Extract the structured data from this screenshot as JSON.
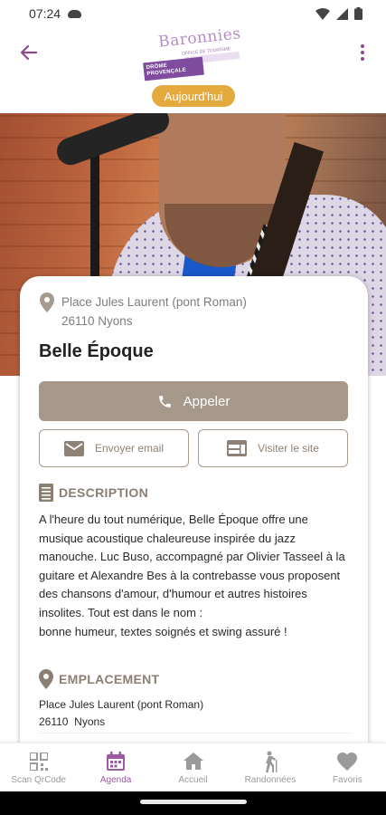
{
  "status_bar": {
    "time": "07:24"
  },
  "header": {
    "logo": {
      "name": "Baronnies",
      "tagline": "OFFICE DE TOURISME",
      "band_line1": "DRÔME",
      "band_line2": "PROVENÇALE"
    },
    "badge": "Aujourd'hui"
  },
  "event": {
    "address_line1": "Place Jules Laurent (pont Roman)",
    "address_line2": "26110 Nyons",
    "title": "Belle Époque",
    "call_label": "Appeler",
    "email_label": "Envoyer email",
    "website_label": "Visiter le site",
    "description_heading": "DESCRIPTION",
    "description": "A l'heure du tout numérique, Belle Époque offre une musique acoustique chaleureuse inspirée du jazz manouche. Luc Buso, accompagné par Olivier Tasseel à la guitare et Alexandre Bes à la contrebasse vous proposent des chansons d'amour, d'humour et autres histoires insolites. Tout est dans le nom :\nbonne humeur, textes soignés et swing assuré !",
    "location_heading": "EMPLACEMENT",
    "location_line1": "Place Jules Laurent (pont Roman)",
    "location_line2": "26110  Nyons"
  },
  "nav": {
    "items": [
      {
        "label": "Scan QrCode",
        "icon": "qrcode-icon",
        "active": false
      },
      {
        "label": "Agenda",
        "icon": "calendar-icon",
        "active": true
      },
      {
        "label": "Accueil",
        "icon": "home-icon",
        "active": false
      },
      {
        "label": "Randonnées",
        "icon": "hiker-icon",
        "active": false
      },
      {
        "label": "Favoris",
        "icon": "heart-icon",
        "active": false
      }
    ]
  },
  "colors": {
    "accent": "#9b5aa1",
    "badge": "#e4aa3d",
    "primary_button": "#a6998b",
    "section_heading": "#8b7f74"
  }
}
